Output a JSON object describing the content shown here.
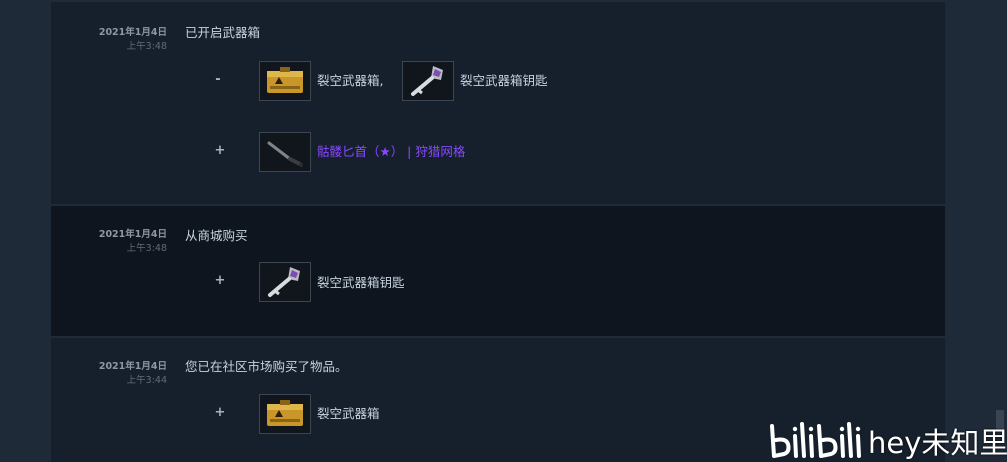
{
  "entries": [
    {
      "date": "2021年1月4日",
      "time": "上午3:48",
      "description": "已开启武器箱",
      "items": [
        {
          "sign": "-",
          "icon": "weapon-case-icon",
          "name": "裂空武器箱,",
          "rarity": "normal"
        },
        {
          "icon": "case-key-icon",
          "name": "裂空武器箱钥匙",
          "rarity": "normal"
        },
        {
          "sign": "+",
          "icon": "knife-icon",
          "name": "骷髅匕首（★） | 狩猎网格",
          "rarity": "covert"
        }
      ]
    },
    {
      "date": "2021年1月4日",
      "time": "上午3:48",
      "description": "从商城购买",
      "items": [
        {
          "sign": "+",
          "icon": "case-key-icon",
          "name": "裂空武器箱钥匙",
          "rarity": "normal"
        }
      ]
    },
    {
      "date": "2021年1月4日",
      "time": "上午3:44",
      "description": "您已在社区市场购买了物品。",
      "items": [
        {
          "sign": "+",
          "icon": "weapon-case-icon",
          "name": "裂空武器箱",
          "rarity": "normal"
        }
      ]
    }
  ],
  "colors": {
    "rare_item": "#8847ff",
    "text": "#c6d4df",
    "background": "#16202d"
  },
  "watermark": {
    "logo": "bilibili",
    "text": "hey未知里"
  }
}
